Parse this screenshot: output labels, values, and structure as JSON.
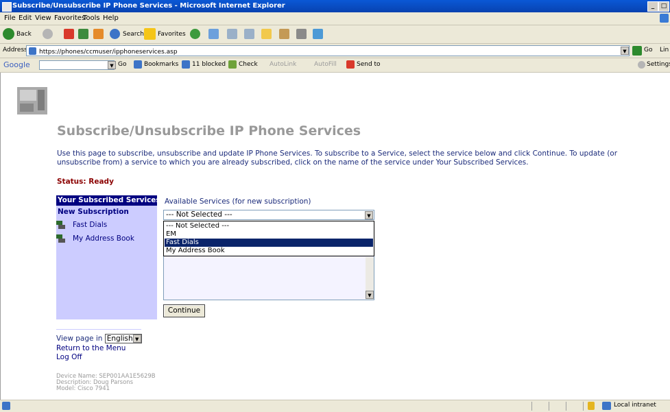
{
  "window": {
    "title": "Subscribe/Unsubscribe IP Phone Services - Microsoft Internet Explorer"
  },
  "menubar": [
    "File",
    "Edit",
    "View",
    "Favorites",
    "Tools",
    "Help"
  ],
  "toolbar": {
    "back": "Back",
    "search": "Search",
    "favorites": "Favorites"
  },
  "addressbar": {
    "label": "Address",
    "url": "https://phones/ccmuser/ipphoneservices.asp",
    "go": "Go",
    "links": "Lin"
  },
  "googlebar": {
    "logo": "Google",
    "go": "Go",
    "bookmarks": "Bookmarks",
    "blocked": "11 blocked",
    "check": "Check",
    "autolink": "AutoLink",
    "autofill": "AutoFill",
    "send_to": "Send to",
    "settings": "Settings"
  },
  "page": {
    "title": "Subscribe/Unsubscribe IP Phone Services",
    "intro": "Use this page to subscribe, unsubscribe and update IP Phone Services. To subscribe to a Service, select the service below and click Continue. To update (or unsubscribe from) a service to which you are already subscribed, click on the name of the service under Your Subscribed Services.",
    "status": "Status: Ready"
  },
  "sidebar": {
    "header": "Your Subscribed Services",
    "new_subscription": "New Subscription",
    "services": [
      "Fast Dials",
      "My Address Book"
    ]
  },
  "available": {
    "label": "Available Services (for new subscription)",
    "selected": "--- Not Selected ---",
    "options": [
      "--- Not Selected ---",
      "EM",
      "Fast Dials",
      "My Address Book"
    ],
    "highlighted": "Fast Dials"
  },
  "continue_label": "Continue",
  "footer": {
    "view_page_in": "View page in",
    "language": "English",
    "return_to_menu": "Return to the Menu",
    "log_off": "Log Off",
    "device_name": "Device Name: SEP001AA1E5629B",
    "description": "Description: Doug Parsons",
    "model": "Model: Cisco 7941"
  },
  "statusbar": {
    "zone": "Local intranet"
  },
  "colors": {
    "title_bar": "#0a58d6",
    "sidebar_header": "#000080",
    "sidebar_bg": "#ccccff",
    "status_text": "#8b0000",
    "selection": "#0a246a"
  }
}
